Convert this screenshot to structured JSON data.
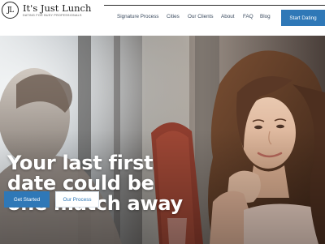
{
  "brand": {
    "logo_mark": "JL",
    "name": "It's Just Lunch",
    "tagline": "DATING FOR BUSY PROFESSIONALS"
  },
  "nav": {
    "items": [
      {
        "label": "Signature Process"
      },
      {
        "label": "Cities"
      },
      {
        "label": "Our Clients"
      },
      {
        "label": "About"
      },
      {
        "label": "FAQ"
      },
      {
        "label": "Blog"
      }
    ],
    "cta": "Start Dating"
  },
  "hero": {
    "headline_lines": [
      "Your last first",
      "date could be",
      "one match away"
    ],
    "primary_button": "Get Started",
    "secondary_button": "Our Process"
  },
  "colors": {
    "accent": "#2f78b7",
    "nav_text": "#3a4a5e"
  }
}
